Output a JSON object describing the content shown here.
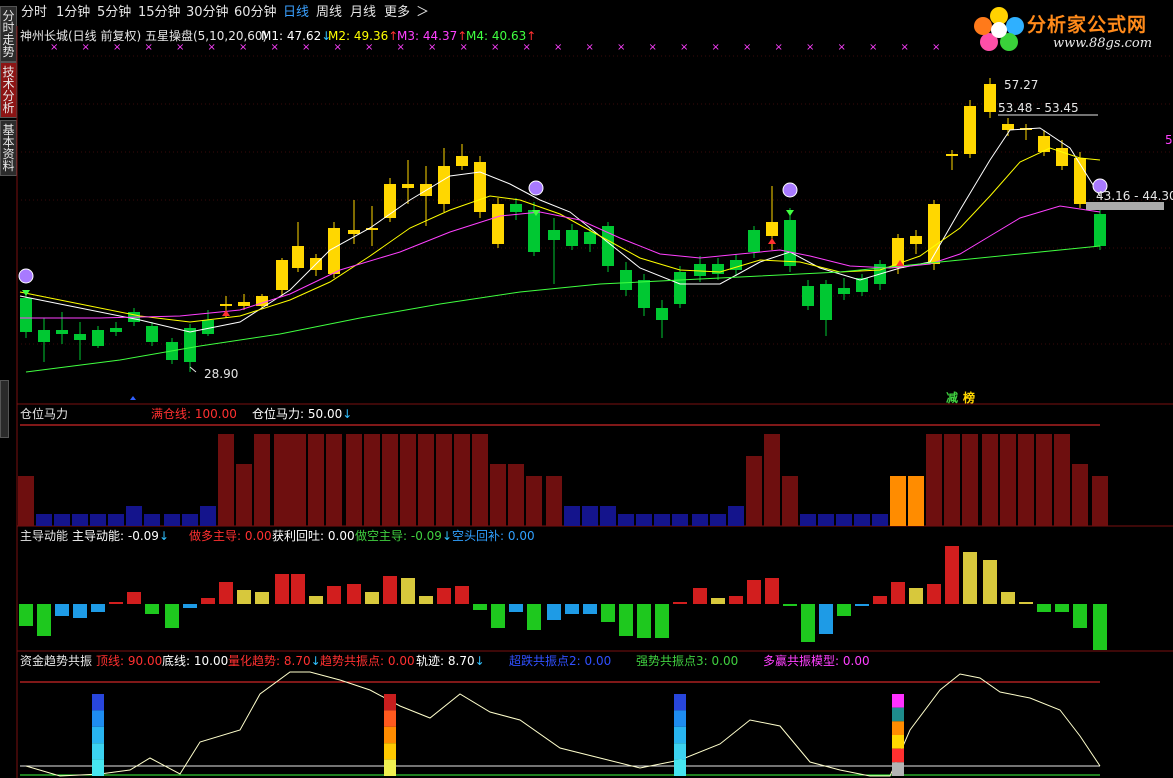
{
  "toolbar": {
    "items": [
      "分时",
      "1分钟",
      "5分钟",
      "15分钟",
      "30分钟",
      "60分钟",
      "日线",
      "周线",
      "月线",
      "更多",
      "＞"
    ],
    "active": "日线"
  },
  "logo": {
    "text": "分析家公式网",
    "url": "www.88gs.com"
  },
  "side_tabs": [
    "分时走势",
    "技术分析",
    "基本资料"
  ],
  "main_panel": {
    "title": "神州长城(日线 前复权) 五星操盘(5,10,20,60)",
    "m1": {
      "label": "M1:",
      "value": "47.62",
      "arrow": "↓",
      "color": "#ffffff"
    },
    "m2": {
      "label": "M2:",
      "value": "49.36",
      "arrow": "↑",
      "color": "#ffff00"
    },
    "m3": {
      "label": "M3:",
      "value": "44.37",
      "arrow": "↑",
      "color": "#ff40ff"
    },
    "m4": {
      "label": "M4:",
      "value": "40.63",
      "arrow": "↑",
      "color": "#40ff40"
    },
    "annotations": {
      "low_price": "28.90",
      "high_price": "57.27",
      "range_1": "53.48 - 53.45",
      "range_2": "43.16 - 44.30",
      "right_edge": "5",
      "signal_1": "减",
      "signal_2": "榜"
    }
  },
  "panel2": {
    "title": "仓位马力",
    "full": {
      "label": "满仓线:",
      "value": "100.00",
      "color": "#ff3030"
    },
    "power": {
      "label": "仓位马力:",
      "value": "50.00",
      "arrow": "↓",
      "color": "#ffffff"
    }
  },
  "panel3": {
    "title": "主导动能",
    "main": {
      "label": "主导动能:",
      "value": "-0.09",
      "arrow": "↓",
      "color": "#ffffff"
    },
    "bull": {
      "label": "做多主导:",
      "value": "0.00",
      "color": "#ff3030"
    },
    "profit": {
      "label": "获利回吐:",
      "value": "0.00",
      "color": "#ffffff"
    },
    "bear": {
      "label": "做空主导:",
      "value": "-0.09",
      "arrow": "↓",
      "color": "#40d040"
    },
    "cover": {
      "label": "空头回补:",
      "value": "0.00",
      "color": "#30a0ff"
    }
  },
  "panel4": {
    "title": "资金趋势共振",
    "top": {
      "label": "顶线:",
      "value": "90.00",
      "color": "#ff3030"
    },
    "bottom": {
      "label": "底线:",
      "value": "10.00",
      "color": "#ffffff"
    },
    "trend": {
      "label": "量化趋势:",
      "value": "8.70",
      "arrow": "↓",
      "color": "#ff3030"
    },
    "resonance": {
      "label": "趋势共振点:",
      "value": "0.00",
      "color": "#ff3030"
    },
    "track": {
      "label": "轨迹:",
      "value": "8.70",
      "arrow": "↓",
      "color": "#ffffff"
    },
    "super2": {
      "label": "超跌共振点2:",
      "value": "0.00",
      "color": "#3050ff"
    },
    "strong3": {
      "label": "强势共振点3:",
      "value": "0.00",
      "color": "#40d040"
    },
    "multi": {
      "label": "多赢共振模型:",
      "value": "0.00",
      "color": "#ff40ff"
    }
  },
  "colors": {
    "up": "#ffd700",
    "down": "#00c832",
    "ma5": "#ffffff",
    "ma10": "#ffff00",
    "ma20": "#ff40ff",
    "ma60": "#40ff40",
    "grid": "#7a1010",
    "red_bar": "#6e0f0f",
    "blue_bar": "#14148c",
    "orange_bar": "#ff8c00"
  }
}
